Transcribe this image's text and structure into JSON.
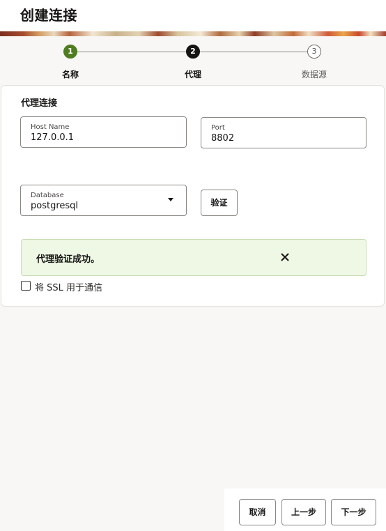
{
  "header": {
    "title": "创建连接"
  },
  "stepper": {
    "steps": [
      {
        "number": "1",
        "label": "名称",
        "state": "completed"
      },
      {
        "number": "2",
        "label": "代理",
        "state": "current"
      },
      {
        "number": "3",
        "label": "数据源",
        "state": "upcoming"
      }
    ]
  },
  "proxy": {
    "section_title": "代理连接",
    "host": {
      "label": "Host Name",
      "value": "127.0.0.1"
    },
    "port": {
      "label": "Port",
      "value": "8802"
    },
    "database": {
      "label": "Database",
      "value": "postgresql"
    },
    "validate_label": "验证",
    "alert": {
      "message": "代理验证成功。",
      "status": "success",
      "icon": "close-icon"
    },
    "ssl": {
      "label": "将 SSL 用于通信",
      "checked": false
    }
  },
  "footer": {
    "cancel_label": "取消",
    "back_label": "上一步",
    "next_label": "下一步"
  },
  "colors": {
    "step_completed": "#4f7d1f",
    "step_current": "#161513",
    "alert_background": "#eef8e5"
  }
}
